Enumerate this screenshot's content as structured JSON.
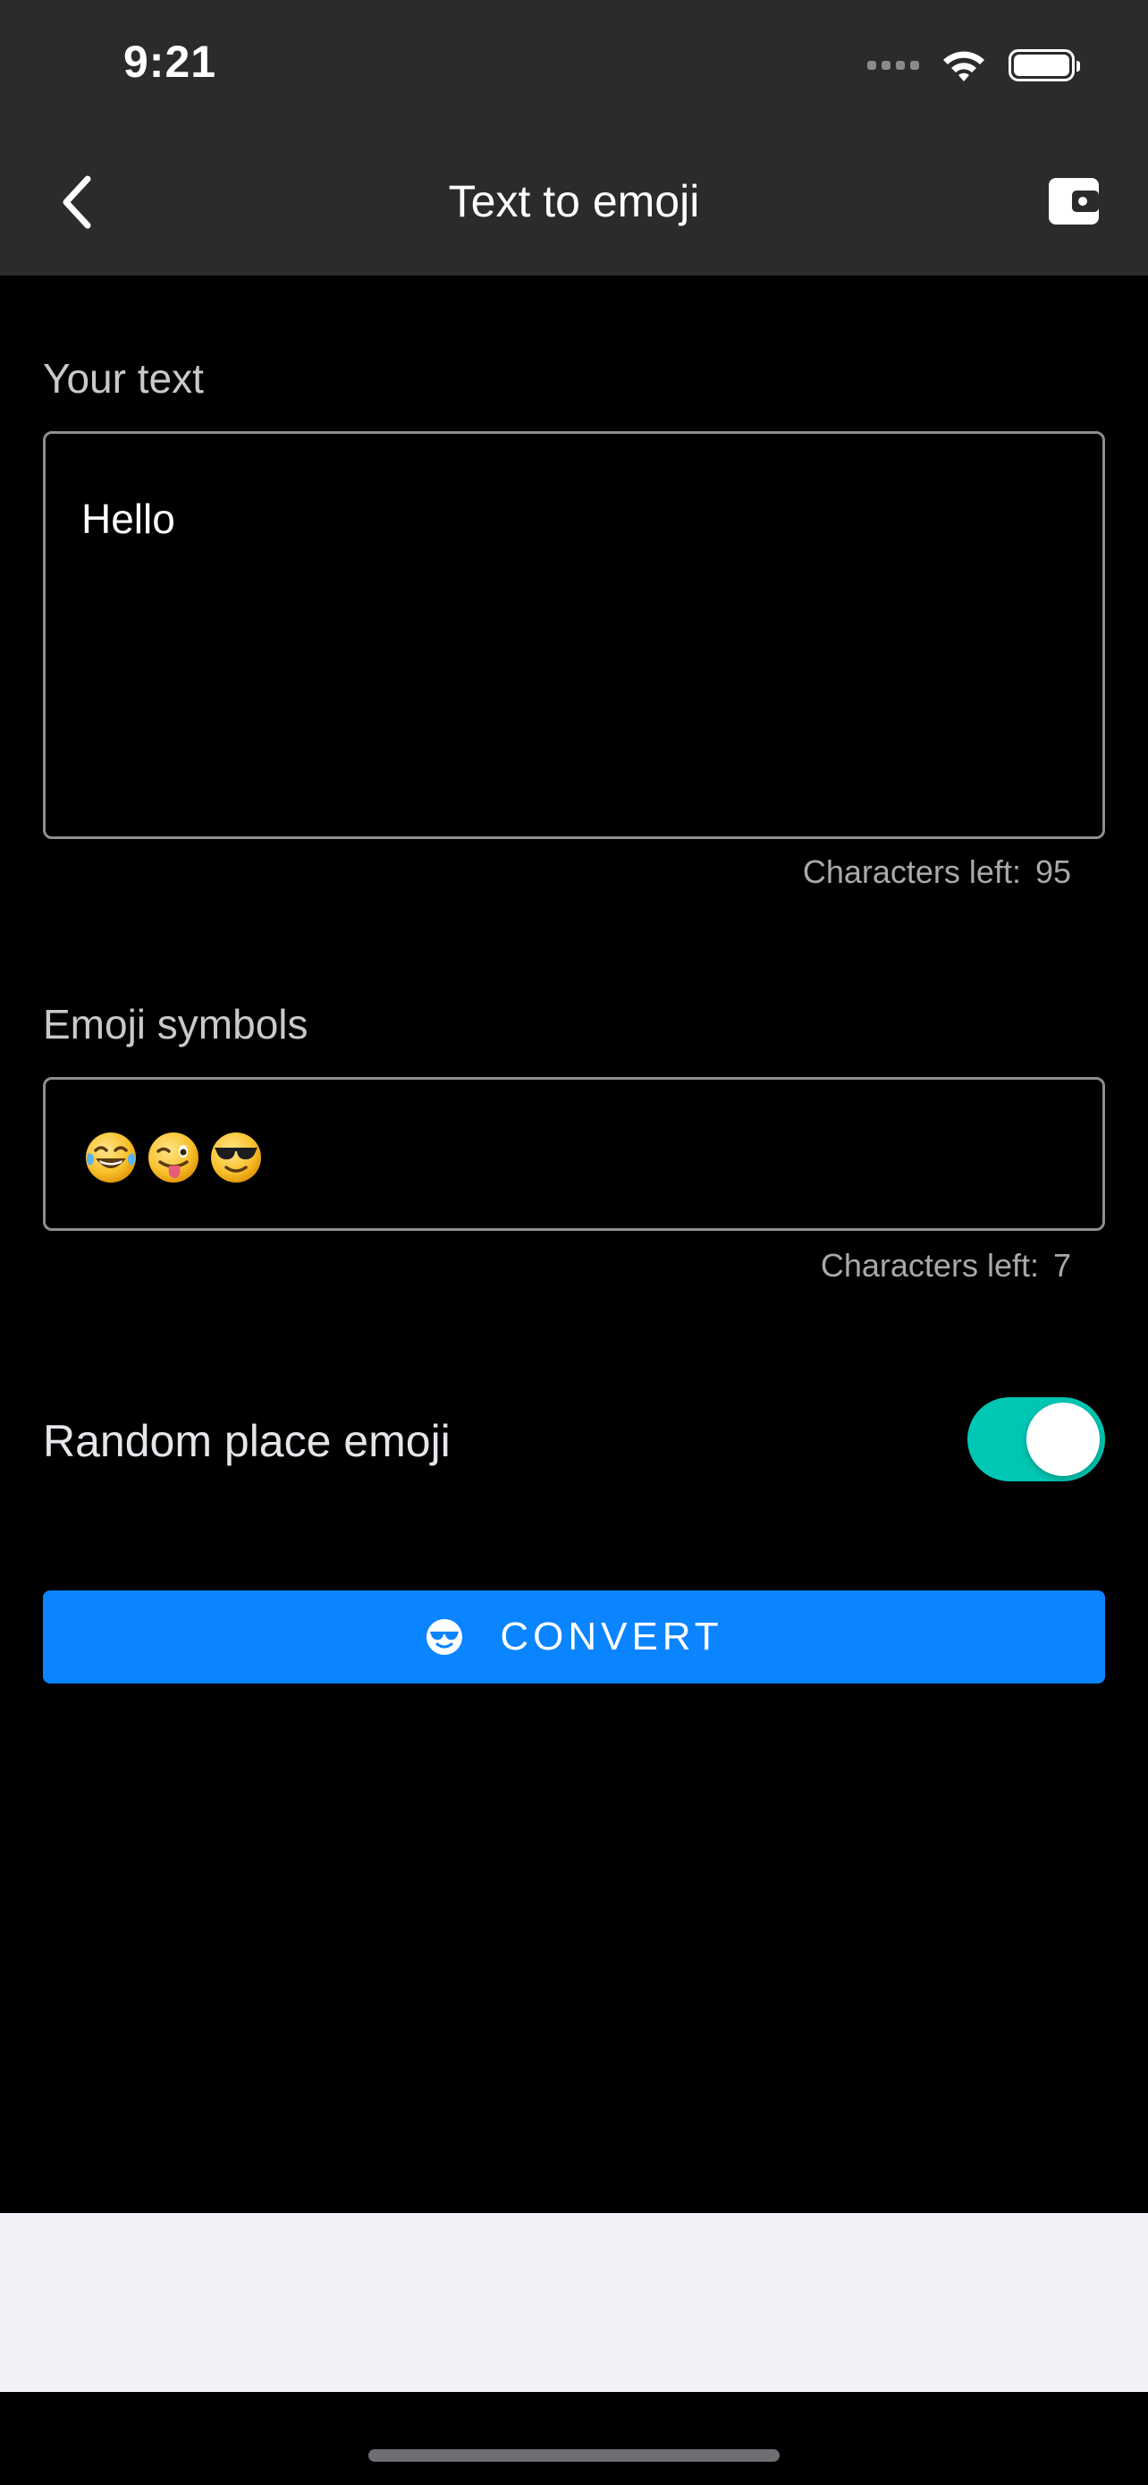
{
  "status_bar": {
    "time": "9:21",
    "wifi_icon": "wifi-icon",
    "battery_icon": "battery-icon"
  },
  "nav": {
    "title": "Text to emoji",
    "back_icon": "chevron-left-icon",
    "wallet_icon": "wallet-icon"
  },
  "text_section": {
    "label": "Your text",
    "value": "Hello",
    "counter_label": "Characters left:",
    "counter_value": "95"
  },
  "emoji_section": {
    "label": "Emoji symbols",
    "symbols": [
      "tears-of-joy-emoji",
      "winking-tongue-emoji",
      "sunglasses-emoji"
    ],
    "counter_label": "Characters left:",
    "counter_value": "7"
  },
  "random_place": {
    "label": "Random place emoji",
    "enabled": true
  },
  "convert_button": {
    "label": "CONVERT",
    "icon": "cool-face-icon"
  },
  "colors": {
    "header_bg": "#2b2b2d",
    "accent_blue": "#0a84ff",
    "toggle_on": "#00c7b4",
    "border": "#8e8e93"
  }
}
